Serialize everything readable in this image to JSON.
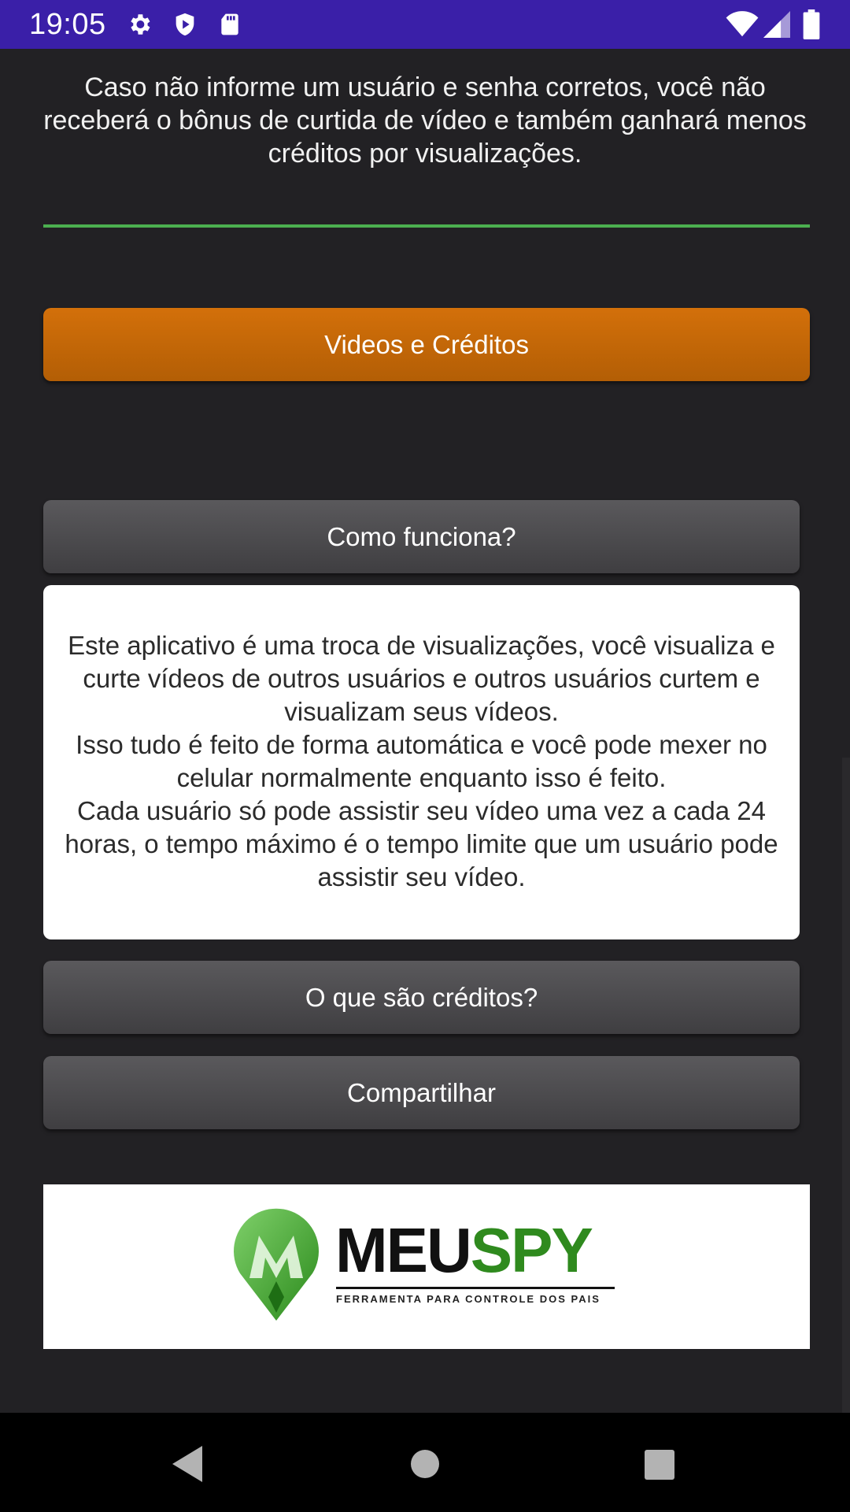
{
  "status_bar": {
    "time": "19:05",
    "icons": [
      "settings-icon",
      "shield-icon",
      "sd-card-icon",
      "wifi-icon",
      "signal-icon",
      "battery-icon"
    ],
    "background": "#3a1fa8"
  },
  "main": {
    "warning_text": "Caso não informe um usuário e senha corretos, você não receberá o bônus de curtida de vídeo e também ganhará menos créditos por visualizações.",
    "videos_button_label": "Videos e Créditos",
    "how_it_works_label": "Como funciona?",
    "how_it_works_text": "Este aplicativo é uma troca de visualizações, você visualiza e curte vídeos de outros usuários e outros usuários curtem e visualizam seus vídeos.\nIsso tudo é feito de forma automática e você pode mexer no celular normalmente enquanto isso é feito.\nCada usuário só pode assistir seu vídeo uma vez a cada 24 horas, o tempo máximo é o tempo limite que um usuário pode assistir seu vídeo.",
    "credits_label": "O que são créditos?",
    "share_label": "Compartilhar"
  },
  "banner": {
    "brand_part1": "MEU",
    "brand_part2": "SPY",
    "tagline": "FERRAMENTA PARA CONTROLE DOS PAIS",
    "brand_color": "#2f8a1e"
  },
  "nav_bar": {
    "icons": [
      "back-icon",
      "home-icon",
      "recents-icon"
    ]
  },
  "colors": {
    "accent_orange": "#d3700a",
    "input_underline": "#4caf50",
    "background": "#222124"
  }
}
